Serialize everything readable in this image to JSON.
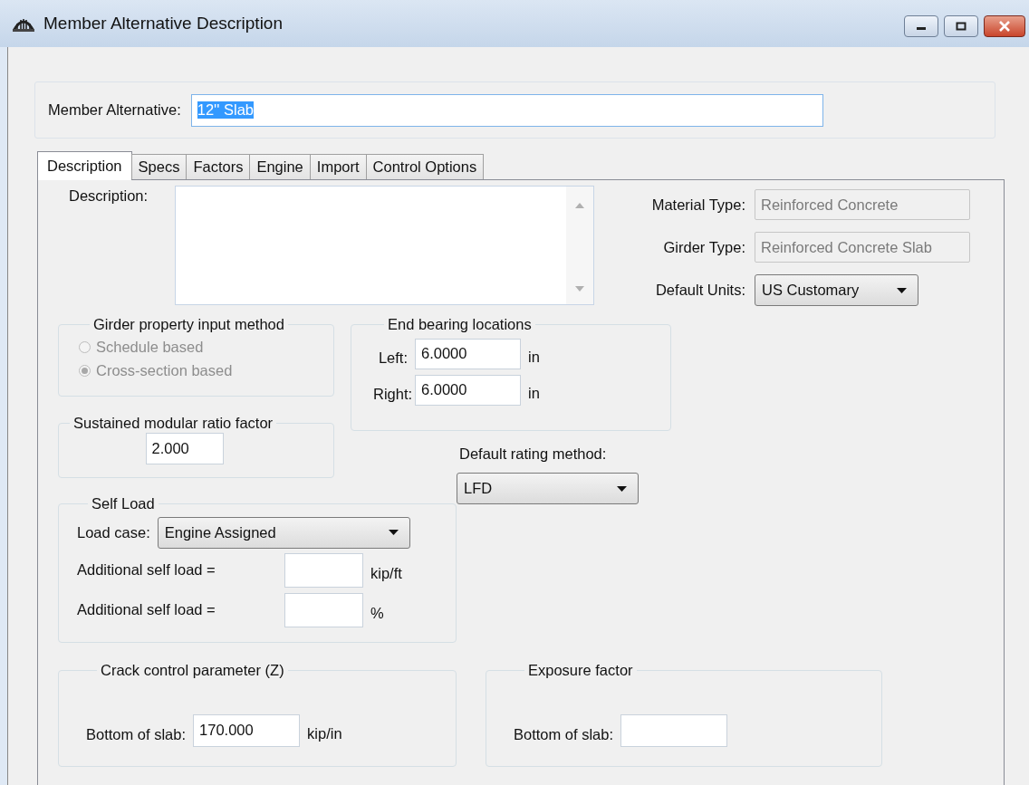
{
  "window": {
    "title": "Member Alternative Description"
  },
  "member_alternative": {
    "label": "Member Alternative:",
    "value": "12'' Slab",
    "text_selected": true
  },
  "tabs": [
    {
      "label": "Description",
      "selected": true
    },
    {
      "label": "Specs",
      "selected": false
    },
    {
      "label": "Factors",
      "selected": false
    },
    {
      "label": "Engine",
      "selected": false
    },
    {
      "label": "Import",
      "selected": false
    },
    {
      "label": "Control Options",
      "selected": false
    }
  ],
  "description": {
    "label": "Description:"
  },
  "properties": [
    {
      "label": "Material Type:",
      "value": "Reinforced Concrete",
      "kind": "readonly"
    },
    {
      "label": "Girder Type:",
      "value": "Reinforced Concrete Slab",
      "kind": "readonly"
    },
    {
      "label": "Default Units:",
      "value": "US Customary",
      "kind": "dropdown"
    }
  ],
  "girder_property_input_method": {
    "title": "Girder property input method",
    "disabled": true,
    "options": [
      {
        "label": "Schedule based",
        "selected": false
      },
      {
        "label": "Cross-section based",
        "selected": true
      }
    ]
  },
  "end_bearing_locations": {
    "title": "End bearing locations",
    "rows": [
      {
        "label": "Left:",
        "value": "6.0000",
        "unit": "in"
      },
      {
        "label": "Right:",
        "value": "6.0000",
        "unit": "in"
      }
    ]
  },
  "sustained_modular_ratio_factor": {
    "title": "Sustained modular ratio factor",
    "value": "2.000"
  },
  "default_rating_method": {
    "label": "Default rating method:",
    "value": "LFD"
  },
  "self_load": {
    "title": "Self Load",
    "load_case": {
      "label": "Load case:",
      "value": "Engine Assigned"
    },
    "additional": [
      {
        "label": "Additional self load =",
        "unit": "kip/ft"
      },
      {
        "label": "Additional self load =",
        "unit": "%"
      }
    ]
  },
  "crack_control": {
    "title": "Crack control parameter (Z)",
    "label": "Bottom of slab:",
    "value": "170.000",
    "unit": "kip/in"
  },
  "exposure_factor": {
    "title": "Exposure factor",
    "label": "Bottom of slab:"
  }
}
